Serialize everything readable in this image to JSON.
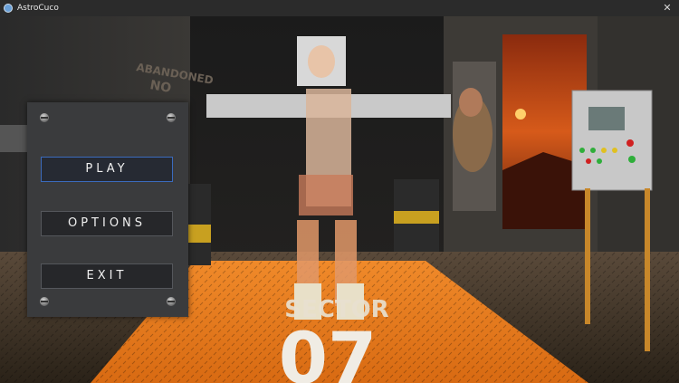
{
  "window": {
    "title": "AstroCuco",
    "close_glyph": "✕"
  },
  "menu": {
    "buttons": [
      {
        "label": "PLAY",
        "selected": true
      },
      {
        "label": "OPTIONS",
        "selected": false
      },
      {
        "label": "EXIT",
        "selected": false
      }
    ]
  },
  "scene": {
    "floor_text_line1": "SECTOR",
    "floor_text_line2": "07",
    "wall_sign": "ABANDONED",
    "wall_sign2": "NO"
  },
  "colors": {
    "titlebar": "#2b2b2b",
    "panel": "#3a3b3d",
    "button_fill": "#26272a",
    "selected_border": "#3b6bbd",
    "floor": "#e8852a"
  }
}
